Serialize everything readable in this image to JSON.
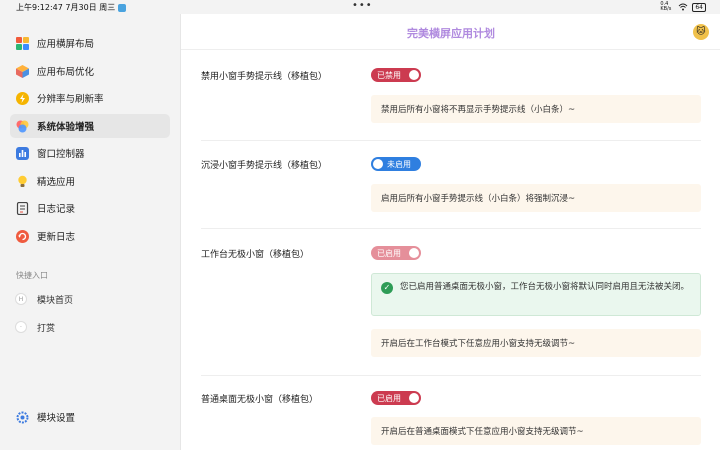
{
  "status_bar": {
    "time": "上午9:12:47",
    "date": "7月30日 周三",
    "dots": "•••",
    "speed": "0.4 KB/s",
    "battery": "64"
  },
  "sidebar": {
    "items": [
      {
        "label": "应用横屏布局",
        "icon": "grid-icon"
      },
      {
        "label": "应用布局优化",
        "icon": "cube-icon"
      },
      {
        "label": "分辨率与刷新率",
        "icon": "bolt-icon"
      },
      {
        "label": "系统体验增强",
        "icon": "palette-icon"
      },
      {
        "label": "窗口控制器",
        "icon": "bars-icon"
      },
      {
        "label": "精选应用",
        "icon": "bulb-icon"
      },
      {
        "label": "日志记录",
        "icon": "log-icon"
      },
      {
        "label": "更新日志",
        "icon": "refresh-icon"
      }
    ],
    "active_index": 3,
    "quick_section_label": "快捷入口",
    "quick_items": [
      {
        "label": "模块首页",
        "glyph": "H"
      },
      {
        "label": "打赏",
        "glyph": "·"
      }
    ],
    "settings_label": "模块设置"
  },
  "header": {
    "title": "完美横屏应用计划"
  },
  "settings": [
    {
      "title": "禁用小窗手势提示线（移植包）",
      "toggle_label": "已禁用",
      "toggle_on": true,
      "toggle_color": "#cc3b50",
      "description": "禁用后所有小窗将不再显示手势提示线（小白条）~"
    },
    {
      "title": "沉浸小窗手势提示线（移植包）",
      "toggle_label": "未启用",
      "toggle_on": false,
      "toggle_color": "#2f7fe0",
      "description": "启用后所有小窗手势提示线（小白条）将强制沉浸~"
    },
    {
      "title": "工作台无极小窗（移植包）",
      "toggle_label": "已启用",
      "toggle_on": true,
      "toggle_color": "#e58f9a",
      "notice": "您已启用普通桌面无极小窗，工作台无极小窗将默认同时启用且无法被关闭。",
      "description": "开启后在工作台模式下任意应用小窗支持无级调节~"
    },
    {
      "title": "普通桌面无极小窗（移植包）",
      "toggle_label": "已启用",
      "toggle_on": true,
      "toggle_color": "#cc3b50",
      "description": "开启后在普通桌面模式下任意应用小窗支持无级调节~"
    }
  ]
}
